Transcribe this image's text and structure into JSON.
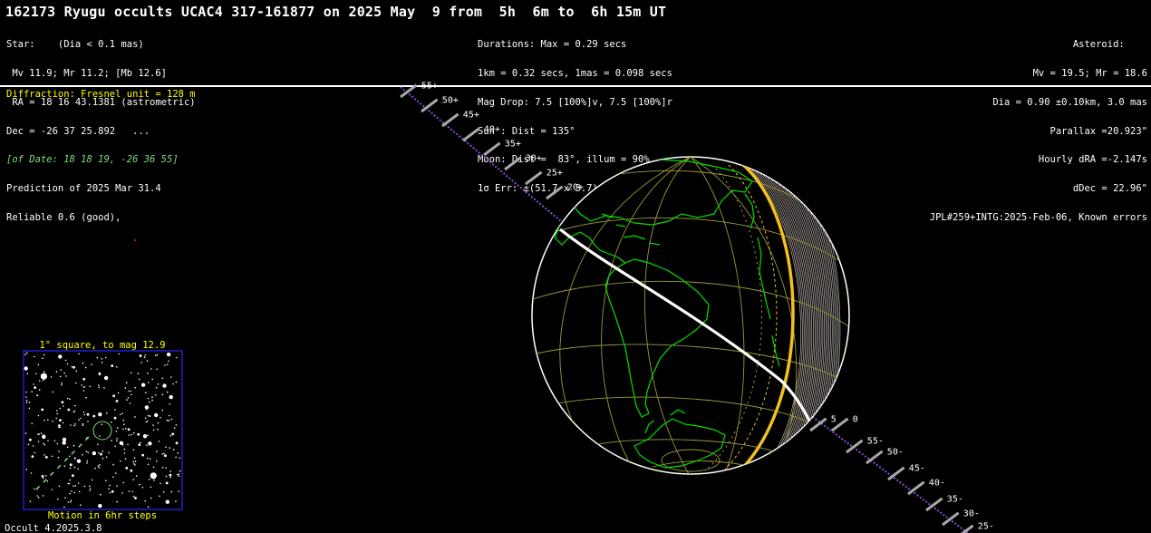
{
  "title": "162173 Ryugu occults UCAC4 317-161877 on 2025 May  9 from  5h  6m to  6h 15m UT",
  "star": {
    "lines": [
      "Star:    (Dia < 0.1 mas)",
      " Mv 11.9; Mr 11.2; [Mb 12.6]",
      " RA = 18 16 43.1381 (astrometric)",
      "Dec = -26 37 25.892   ...",
      "[of Date: 18 18 19, -26 36 55]",
      "Prediction of 2025 Mar 31.4",
      "Reliable 0.6 (good),"
    ]
  },
  "event": {
    "lines": [
      "Durations: Max = 0.29 secs",
      "1km = 0.32 secs, 1mas = 0.098 secs",
      "Mag Drop: 7.5 [100%]v, 7.5 [100%]r",
      "Sun : Dist = 135°",
      "Moon: Dist =  83°, illum = 90%",
      "1σ Err: ±(51.7 x 3.7) mas in PA 78°"
    ]
  },
  "asteroid": {
    "lines": [
      "Asteroid:    ",
      "Mv = 19.5; Mr = 18.6",
      "Dia = 0.90 ±0.10km, 3.0 mas",
      "Parallax =20.923\"",
      "Hourly dRA =-2.147s",
      "dDec = 22.96\"",
      "JPL#259+INTG:2025-Feb-06, Known errors"
    ]
  },
  "diffraction": "Diffraction: Fresnel unit = 128 m",
  "finder": {
    "title": "1° square, to mag 12.9",
    "caption": "Motion in 6hr steps"
  },
  "footer": "Occult 4.2025.3.8",
  "track_labels": {
    "upper": [
      "55+",
      "50+",
      "45+",
      "40+",
      "35+",
      "30+",
      "25+",
      "20+"
    ],
    "lower": [
      "5",
      "0",
      "55-",
      "50-",
      "45-",
      "40-",
      "35-",
      "30-",
      "25-"
    ]
  },
  "colors": {
    "background": "#000000",
    "text": "#ffffff",
    "highlight": "#ffff00",
    "coastline": "#00e000",
    "graticule": "#9a9a3a",
    "path": "#ffffff",
    "sun_terminator": "#f0c020",
    "track_dashes": "#8a4fd6"
  }
}
